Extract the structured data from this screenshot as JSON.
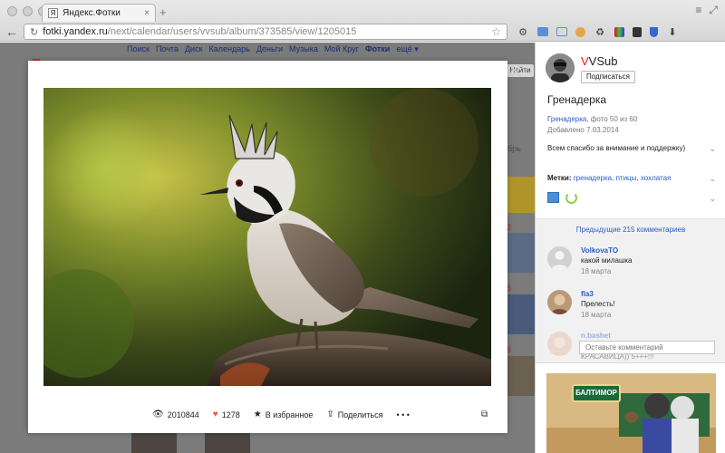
{
  "browser": {
    "tab_title": "Яндекс.Фотки",
    "tab_favicon": "Я",
    "url_host": "fotki.yandex.ru",
    "url_path": "/next/calendar/users/vvsub/album/373585/view/1205015",
    "extension_icons": [
      "gear-icon",
      "window-icon",
      "window-icon",
      "cookie-icon",
      "recycle-icon",
      "color-icon",
      "puzzle-icon",
      "shield-icon",
      "download-icon"
    ]
  },
  "background_page": {
    "nav": [
      "Поиск",
      "Почта",
      "Диск",
      "Календарь",
      "Деньги",
      "Музыка",
      "Мой Круг",
      "Фотки",
      "ещё ▾"
    ],
    "next_label": "Найти",
    "side_text": "брь",
    "side_numbers": [
      "2",
      "6",
      "6"
    ]
  },
  "viewer": {
    "views": "2010844",
    "likes": "1278",
    "favorite_label": "В избранное",
    "share_label": "Поделиться",
    "more_label": "• • •"
  },
  "panel": {
    "author_initial": "V",
    "author_rest": "VSub",
    "subscribe_label": "Подписаться",
    "photo_title": "Гренадерка",
    "album_link": "Гренадерка",
    "album_position": ", фото 50 из 60",
    "added": "Добавлено 7.03.2014",
    "description": "Всем спасибо за внимание и поддержку)",
    "tags_label": "Метки:",
    "tags": "гренадерка, птицы, хохлатая",
    "previous_comments": "Предыдущие 215 комментариев",
    "comments": [
      {
        "name": "VolkovaTO",
        "text": "какой милашка",
        "date": "18 марта"
      },
      {
        "name": "fla3",
        "text": "Прелесть!",
        "date": "18 марта"
      },
      {
        "name": "n.bashet",
        "text": "КРАСАВИЦА)) 5+++!!!",
        "date": ""
      }
    ],
    "comment_placeholder": "Оставьте комментарий",
    "ad_brand": "БАЛТИМОР"
  }
}
